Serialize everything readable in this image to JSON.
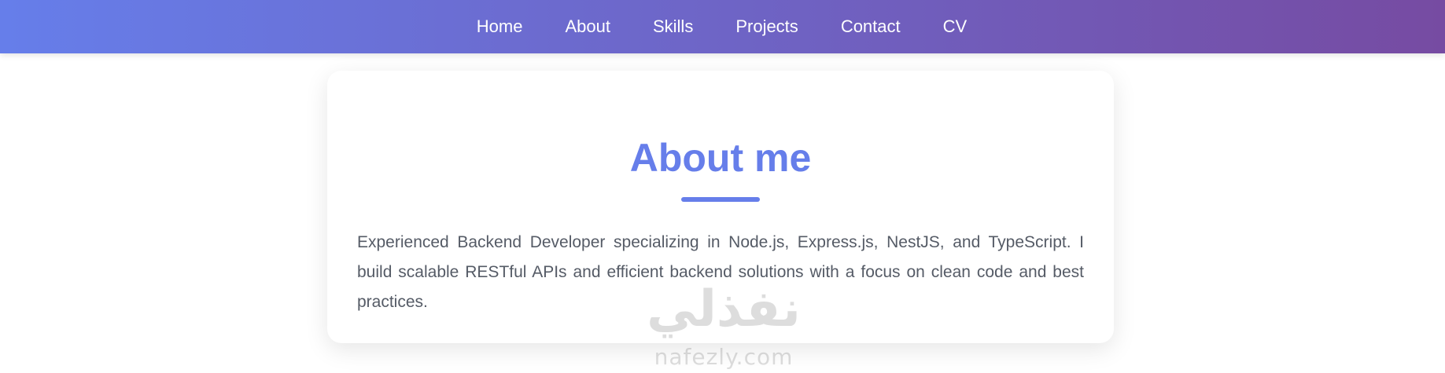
{
  "nav": {
    "items": [
      {
        "label": "Home"
      },
      {
        "label": "About"
      },
      {
        "label": "Skills"
      },
      {
        "label": "Projects"
      },
      {
        "label": "Contact"
      },
      {
        "label": "CV"
      }
    ]
  },
  "about": {
    "title": "About me",
    "text": "Experienced Backend Developer specializing in Node.js, Express.js, NestJS, and TypeScript. I build scalable RESTful APIs and efficient backend solutions with a focus on clean code and best practices."
  },
  "watermark": {
    "arabic": "نفذلي",
    "latin": "nafezly.com"
  },
  "colors": {
    "gradient_start": "#667eea",
    "gradient_end": "#764ba2",
    "accent": "#667eea"
  }
}
